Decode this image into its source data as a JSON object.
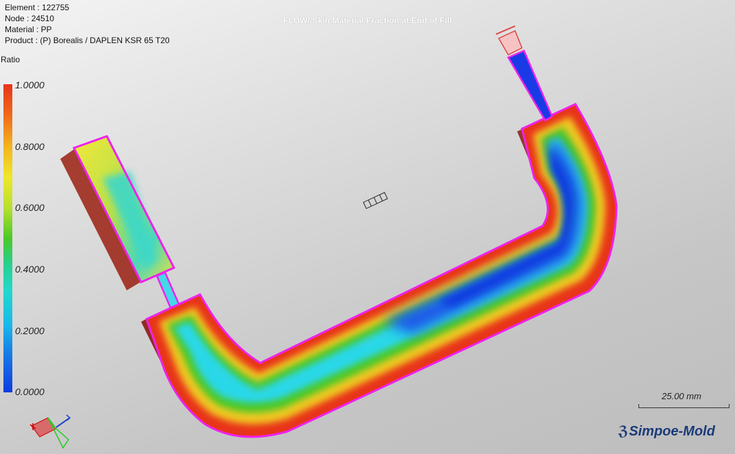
{
  "info": {
    "element": "Element : 122755",
    "node": "Node : 24510",
    "material": "Material : PP",
    "product": "Product : (P)  Borealis / DAPLEN KSR 65 T20"
  },
  "title": "FLOW/ Skin Material Fraction at End of Fill",
  "legend": {
    "label": "Ratio",
    "ticks": [
      "1.0000",
      "0.8000",
      "0.6000",
      "0.4000",
      "0.2000",
      "0.0000"
    ]
  },
  "scale": {
    "label": "25.00 mm"
  },
  "logo": {
    "text": "Simpoe-Mold"
  },
  "colors": {
    "outline": "#ee22ee",
    "high": "#e8341a",
    "low": "#0c3ce0"
  },
  "icons": {
    "axis_triad": "axis-triad-icon",
    "camera": "camera-icon",
    "injection_point": "injection-point-icon"
  }
}
